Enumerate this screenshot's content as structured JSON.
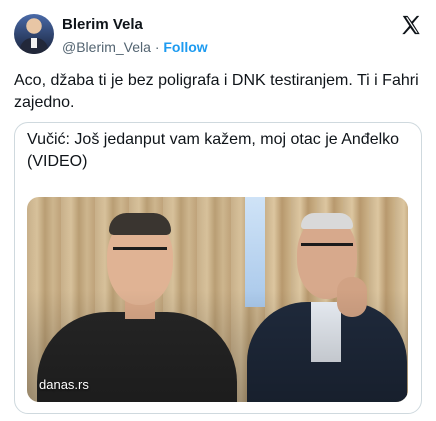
{
  "author": {
    "name": "Blerim Vela",
    "handle": "@Blerim_Vela",
    "separator": "·",
    "follow_label": "Follow"
  },
  "platform_icon": "x-logo-icon",
  "tweet": {
    "text": "Aco, džaba ti je bez poligrafa i DNK testiranjem. Ti i Fahri zajedno."
  },
  "card": {
    "title": "Vučić: Još jedanput vam kažem, moj otac je Anđelko (VIDEO)",
    "source": "danas.rs"
  },
  "colors": {
    "accent": "#1d9bf0",
    "text": "#0f1419",
    "muted": "#536471",
    "border": "#cfd9de"
  }
}
